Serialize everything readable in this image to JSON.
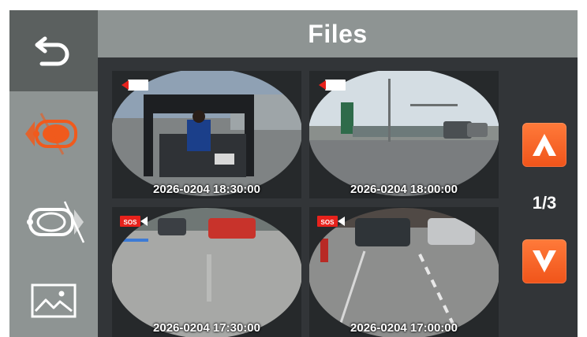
{
  "header": {
    "title": "Files"
  },
  "sidebar": {
    "back_icon": "back-arrow-icon",
    "items": [
      {
        "id": "front",
        "icon": "front-camera-icon",
        "active": true,
        "accent": "#f05a1c"
      },
      {
        "id": "rear",
        "icon": "rear-camera-icon",
        "active": false
      },
      {
        "id": "photos",
        "icon": "image-gallery-icon",
        "active": false
      }
    ]
  },
  "thumbnails": [
    {
      "timestamp": "2026-0204 18:30:00",
      "tag": "recording-icon"
    },
    {
      "timestamp": "2026-0204 18:00:00",
      "tag": "recording-icon"
    },
    {
      "timestamp": "2026-0204 17:30:00",
      "tag": "SOS"
    },
    {
      "timestamp": "2026-0204 17:00:00",
      "tag": "SOS"
    }
  ],
  "pager": {
    "indicator": "1/3",
    "up_icon": "chevron-up-icon",
    "down_icon": "chevron-down-icon"
  },
  "colors": {
    "accent": "#f05a1c",
    "sidebar": "#8e9493",
    "background": "#323538"
  }
}
